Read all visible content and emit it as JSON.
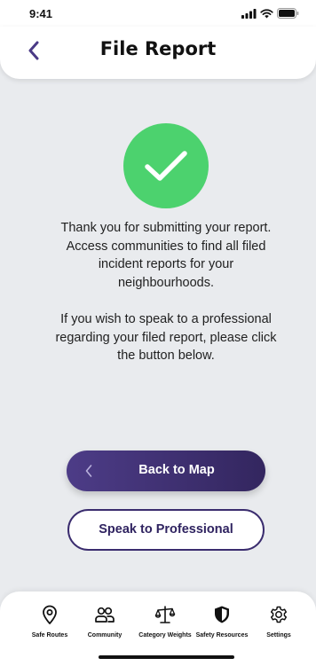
{
  "status_bar": {
    "time": "9:41",
    "icons": [
      "signal-icon",
      "wifi-icon",
      "battery-icon"
    ]
  },
  "header": {
    "title": "File Report",
    "back_icon": "chevron-left-icon"
  },
  "success": {
    "icon": "checkmark-icon",
    "color": "#4cd26e",
    "message_1": "Thank you for submitting your report. Access communities to find all filed incident reports for your neighbourhoods.",
    "message_2": "If you wish to speak to a professional regarding your filed report, please click the button below."
  },
  "buttons": {
    "back_to_map": "Back to Map",
    "speak_to_professional": "Speak to Professional"
  },
  "tabbar": {
    "items": [
      {
        "label": "Safe Routes",
        "icon": "location-pin-icon"
      },
      {
        "label": "Community",
        "icon": "users-icon"
      },
      {
        "label": "Category Weights",
        "icon": "scale-icon"
      },
      {
        "label": "Safety Resources",
        "icon": "shield-icon"
      },
      {
        "label": "Settings",
        "icon": "gear-icon"
      }
    ]
  },
  "colors": {
    "accent": "#3a2c6e",
    "background": "#e9ebee",
    "success": "#4cd26e"
  }
}
